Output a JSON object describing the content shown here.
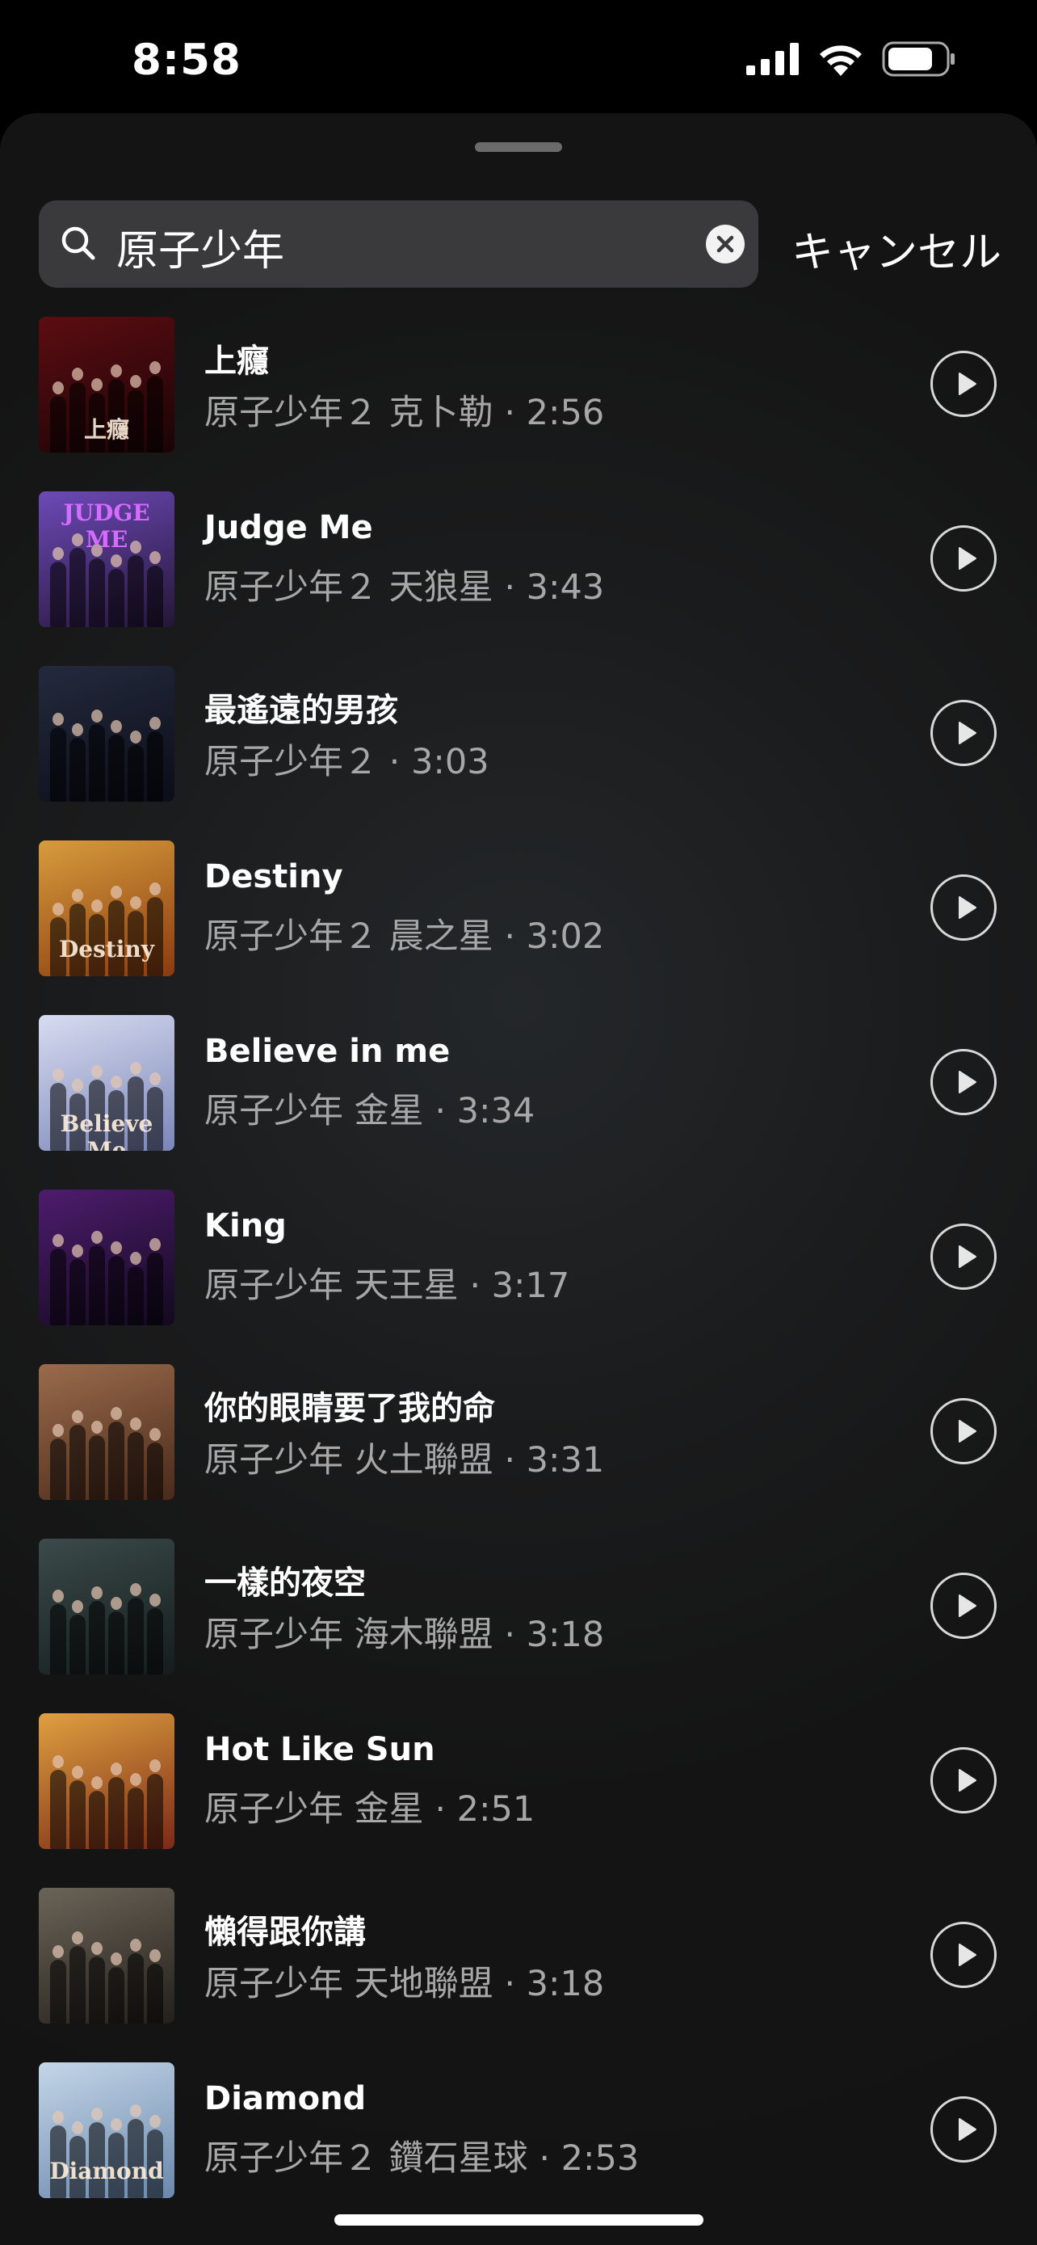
{
  "status_bar": {
    "time": "8:58"
  },
  "search": {
    "query": "原子少年",
    "cancel_label": "キャンセル"
  },
  "tracks": [
    {
      "title": "上癮",
      "meta": "原子少年２ 克卜勒 · 2:56",
      "cover_colors": [
        "#5c0d12",
        "#1a0406"
      ],
      "cover_label": "上癮"
    },
    {
      "title": "Judge Me",
      "meta": "原子少年２ 天狼星 · 3:43",
      "cover_colors": [
        "#6d4ab8",
        "#241636"
      ],
      "cover_label": "JUDGE ME"
    },
    {
      "title": "最遙遠的男孩",
      "meta": "原子少年２ · 3:03",
      "cover_colors": [
        "#242a3e",
        "#0b0d17"
      ],
      "cover_label": ""
    },
    {
      "title": "Destiny",
      "meta": "原子少年２ 晨之星 · 3:02",
      "cover_colors": [
        "#d79c3c",
        "#8a3b10"
      ],
      "cover_label": "Destiny"
    },
    {
      "title": "Believe in me",
      "meta": "原子少年 金星 · 3:34",
      "cover_colors": [
        "#d8dcf0",
        "#7a86b8"
      ],
      "cover_label": "Believe Me"
    },
    {
      "title": "King",
      "meta": "原子少年 天王星 · 3:17",
      "cover_colors": [
        "#4e1c6e",
        "#120a1e"
      ],
      "cover_label": ""
    },
    {
      "title": "你的眼睛要了我的命",
      "meta": "原子少年 火土聯盟 · 3:31",
      "cover_colors": [
        "#9a6b4c",
        "#4a2a1a"
      ],
      "cover_label": ""
    },
    {
      "title": "一樣的夜空",
      "meta": "原子少年 海木聯盟 · 3:18",
      "cover_colors": [
        "#3b4a4a",
        "#151c1c"
      ],
      "cover_label": ""
    },
    {
      "title": "Hot Like Sun",
      "meta": "原子少年 金星 · 2:51",
      "cover_colors": [
        "#e0a040",
        "#7a2a16"
      ],
      "cover_label": ""
    },
    {
      "title": "懶得跟你講",
      "meta": "原子少年 天地聯盟 · 3:18",
      "cover_colors": [
        "#6a6458",
        "#241f1a"
      ],
      "cover_label": ""
    },
    {
      "title": "Diamond",
      "meta": "原子少年２ 鑽石星球 · 2:53",
      "cover_colors": [
        "#c4d6e8",
        "#6a88ac"
      ],
      "cover_label": "Diamond"
    }
  ]
}
